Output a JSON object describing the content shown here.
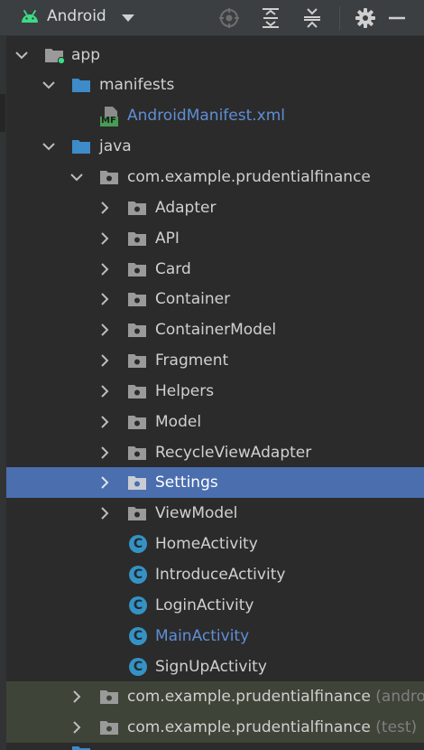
{
  "toolbar": {
    "view_label": "Android"
  },
  "tree": {
    "app": "app",
    "manifests": "manifests",
    "manifest_file": "AndroidManifest.xml",
    "manifest_icon_text": "MF",
    "java": "java",
    "main_package": "com.example.prudentialfinance",
    "folders": [
      "Adapter",
      "API",
      "Card",
      "Container",
      "ContainerModel",
      "Fragment",
      "Helpers",
      "Model",
      "RecycleViewAdapter",
      "Settings",
      "ViewModel"
    ],
    "classes": [
      "HomeActivity",
      "IntroduceActivity",
      "LoginActivity",
      "MainActivity",
      "SignUpActivity"
    ],
    "class_icon_letter": "C",
    "android_test_package": "com.example.prudentialfinance",
    "android_test_suffix": "(androidTest)",
    "test_package": "com.example.prudentialfinance",
    "test_suffix": "(test)"
  },
  "colors": {
    "background": "#2b2b2b",
    "toolbar": "#3c3f41",
    "selection": "#4b6eaf",
    "test_root_bg": "#3e4438",
    "folder_blue": "#3d8bc8",
    "package_gray": "#9a9a9a",
    "class_icon": "#3592c4",
    "link_text": "#5f8ed6",
    "android_green": "#3ddc84"
  },
  "selected_item": "Settings"
}
